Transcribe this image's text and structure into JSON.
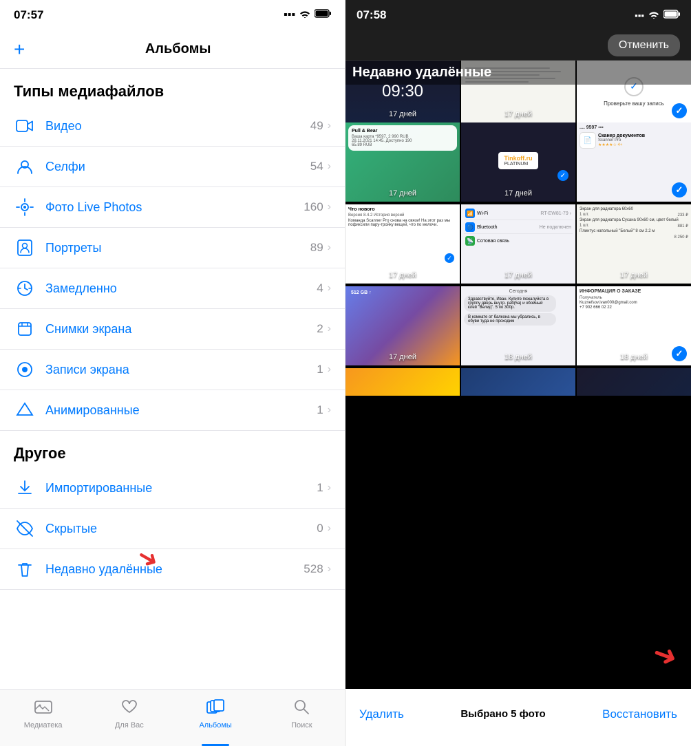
{
  "left": {
    "status_time": "07:57",
    "header": {
      "add_label": "+",
      "title": "Альбомы"
    },
    "section_media": "Типы медиафайлов",
    "media_items": [
      {
        "label": "Видео",
        "count": "49",
        "icon": "video"
      },
      {
        "label": "Селфи",
        "count": "54",
        "icon": "selfie"
      },
      {
        "label": "Фото Live Photos",
        "count": "160",
        "icon": "live-photo"
      },
      {
        "label": "Портреты",
        "count": "89",
        "icon": "portrait"
      },
      {
        "label": "Замедленно",
        "count": "4",
        "icon": "slow-motion"
      },
      {
        "label": "Снимки экрана",
        "count": "2",
        "icon": "screenshot"
      },
      {
        "label": "Записи экрана",
        "count": "1",
        "icon": "screen-record"
      },
      {
        "label": "Анимированные",
        "count": "1",
        "icon": "animated"
      }
    ],
    "section_other": "Другое",
    "other_items": [
      {
        "label": "Импортированные",
        "count": "1",
        "icon": "import"
      },
      {
        "label": "Скрытые",
        "count": "0",
        "icon": "hidden"
      },
      {
        "label": "Недавно удалённые",
        "count": "528",
        "icon": "trash",
        "highlighted": true
      }
    ],
    "tabs": [
      {
        "label": "Медиатека",
        "icon": "photo",
        "active": false
      },
      {
        "label": "Для Вас",
        "icon": "heart",
        "active": false
      },
      {
        "label": "Альбомы",
        "icon": "album",
        "active": true
      },
      {
        "label": "Поиск",
        "icon": "search",
        "active": false
      }
    ]
  },
  "right": {
    "status_time": "07:58",
    "cancel_label": "Отменить",
    "recently_deleted_label": "Недавно удалённые",
    "photos": [
      {
        "days": "17 дней",
        "selected": false,
        "type": "phone"
      },
      {
        "days": "17 дней",
        "selected": false,
        "type": "doc"
      },
      {
        "days": "",
        "selected": false,
        "type": "verify"
      },
      {
        "days": "17 дней",
        "selected": false,
        "type": "phone2"
      },
      {
        "days": "17 дней",
        "selected": false,
        "type": "doc2"
      },
      {
        "days": "",
        "selected": false,
        "type": "faceid"
      },
      {
        "days": "17 дней",
        "selected": false,
        "type": "notification"
      },
      {
        "days": "17 дней",
        "selected": true,
        "type": "app-store"
      },
      {
        "days": "",
        "selected": true,
        "type": "app-store2"
      },
      {
        "days": "17 дней",
        "selected": false,
        "type": "settings"
      },
      {
        "days": "17 дней",
        "selected": true,
        "type": "wifi"
      },
      {
        "days": "17 дней",
        "selected": true,
        "type": "shop"
      },
      {
        "days": "17 дней",
        "selected": false,
        "type": "ipad"
      },
      {
        "days": "18 дней",
        "selected": false,
        "type": "chat"
      },
      {
        "days": "18 дней",
        "selected": true,
        "type": "order"
      }
    ],
    "bottom": {
      "delete_label": "Удалить",
      "selected_info": "Выбрано 5 фото",
      "restore_label": "Восстановить"
    }
  }
}
